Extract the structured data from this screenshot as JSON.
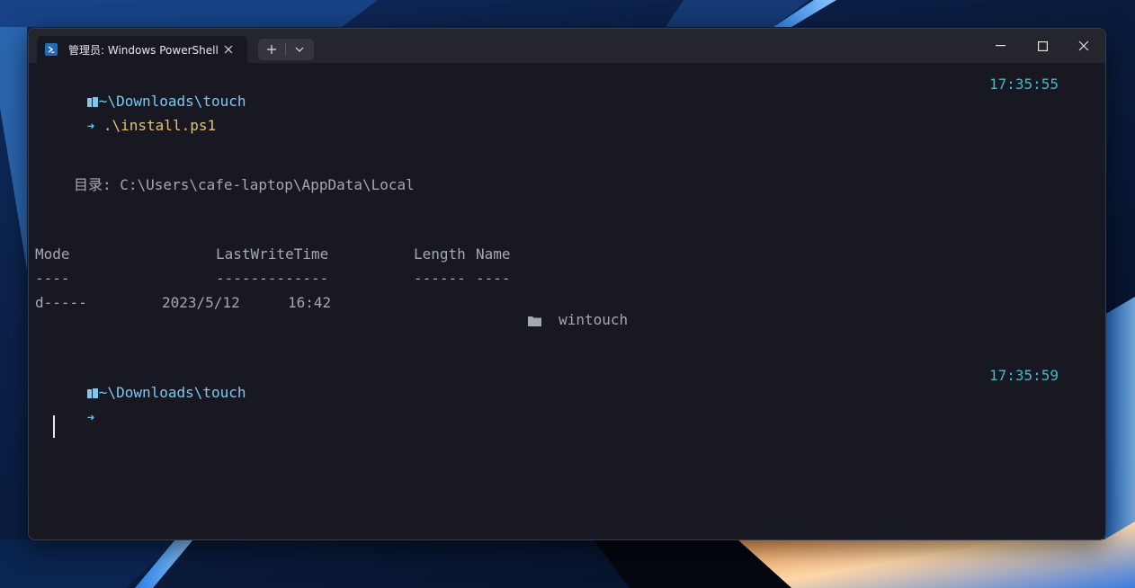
{
  "tab": {
    "title": "管理员: Windows PowerShell",
    "icon": "powershell-icon"
  },
  "toolbar": {
    "new_tab_icon": "plus-icon",
    "dropdown_icon": "chevron-down-icon"
  },
  "window_controls": {
    "minimize_icon": "minimize-icon",
    "maximize_icon": "maximize-icon",
    "close_icon": "close-icon"
  },
  "terminal": {
    "prompt1": {
      "path": "~\\Downloads\\touch",
      "time": "17:35:55",
      "arrow": "➜",
      "command": ".\\install.ps1"
    },
    "directory_line": "目录: C:\\Users\\cafe-laptop\\AppData\\Local",
    "table": {
      "headers": {
        "mode": "Mode",
        "last_write_time": "LastWriteTime",
        "length": "Length",
        "name": "Name"
      },
      "underlines": {
        "mode": "----",
        "last_write_time": "-------------",
        "length": "------",
        "name": "----"
      },
      "rows": [
        {
          "mode": "d-----",
          "date": "2023/5/12",
          "time": "16:42",
          "length": "",
          "name": "wintouch",
          "icon": "folder-icon"
        }
      ]
    },
    "prompt2": {
      "path": "~\\Downloads\\touch",
      "time": "17:35:59",
      "arrow": "➜"
    }
  },
  "colors": {
    "background": "#171821",
    "titlebar": "#24252d",
    "path": "#7cc9f0",
    "command": "#e5c07b",
    "muted": "#a4a8b3",
    "time": "#4bb7c6"
  }
}
